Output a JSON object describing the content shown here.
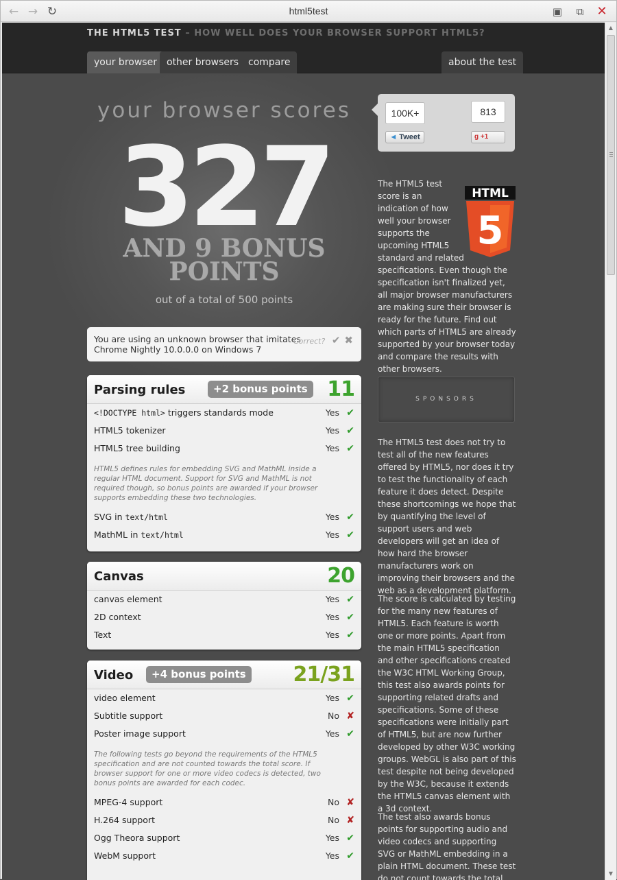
{
  "window": {
    "title": "html5test",
    "icons": {
      "back": "arrow-left-icon",
      "forward": "arrow-right-icon",
      "reload": "reload-icon",
      "fullscreen": "fullscreen-icon",
      "restore": "restore-icon",
      "close": "close-icon"
    }
  },
  "header": {
    "title": "THE HTML5 TEST",
    "subtitle": "– HOW WELL DOES YOUR BROWSER SUPPORT HTML5?",
    "tabs": [
      {
        "label": "your browser"
      },
      {
        "label": "other browsers"
      },
      {
        "label": "compare"
      },
      {
        "label": "about the test"
      }
    ]
  },
  "score": {
    "heading": "your browser scores",
    "value": "327",
    "bonus_line1": "AND 9 BONUS",
    "bonus_line2": "POINTS",
    "out_of": "out of a total of 500 points"
  },
  "browser_info": {
    "line1": "You are using an unknown browser that imitates",
    "line2": "Chrome Nightly 10.0.0.0 on Windows 7",
    "correct_label": "Correct?"
  },
  "social": {
    "tweet_count": "100K+",
    "tweet_label": "Tweet",
    "plus_count": "813",
    "plus_label": "+1"
  },
  "sections": [
    {
      "title": "Parsing rules",
      "bonus": "+2 bonus points",
      "score": "11",
      "rows": [
        {
          "code": "<!DOCTYPE html>",
          "label": " triggers standards mode",
          "result": "Yes",
          "pass": true
        },
        {
          "label": "HTML5 tokenizer",
          "result": "Yes",
          "pass": true
        },
        {
          "label": "HTML5 tree building",
          "result": "Yes",
          "pass": true
        }
      ],
      "note": "HTML5 defines rules for embedding SVG and MathML inside a regular HTML document. Support for SVG and MathML is not required though, so bonus points are awarded if your browser supports embedding these two technologies.",
      "bonus_rows": [
        {
          "label": "SVG in ",
          "code": "text/html",
          "result": "Yes",
          "pass": true
        },
        {
          "label": "MathML in ",
          "code": "text/html",
          "result": "Yes",
          "pass": true
        }
      ]
    },
    {
      "title": "Canvas",
      "score": "20",
      "rows": [
        {
          "label": "canvas element",
          "result": "Yes",
          "pass": true
        },
        {
          "label": "2D context",
          "result": "Yes",
          "pass": true
        },
        {
          "label": "Text",
          "result": "Yes",
          "pass": true
        }
      ]
    },
    {
      "title": "Video",
      "bonus": "+4 bonus points",
      "score": "21/31",
      "rows": [
        {
          "label": "video element",
          "result": "Yes",
          "pass": true
        },
        {
          "label": "Subtitle support",
          "result": "No",
          "pass": false
        },
        {
          "label": "Poster image support",
          "result": "Yes",
          "pass": true
        }
      ],
      "note": "The following tests go beyond the requirements of the HTML5 specification and are not counted towards the total score. If browser support for one or more video codecs is detected, two bonus points are awarded for each codec.",
      "bonus_rows": [
        {
          "label": "MPEG-4 support",
          "result": "No",
          "pass": false
        },
        {
          "label": "H.264 support",
          "result": "No",
          "pass": false
        },
        {
          "label": "Ogg Theora support",
          "result": "Yes",
          "pass": true
        },
        {
          "label": "WebM support",
          "result": "Yes",
          "pass": true
        }
      ]
    }
  ],
  "sidebar": {
    "intro": "The HTML5 test score is an indication of how well your browser supports the upcoming HTML5 standard and related specifications. Even though the specification isn't finalized yet, all major browser manufacturers are making sure their browser is ready for the future. Find out which parts of HTML5 are already supported by your browser today and compare the results with other browsers.",
    "html5_logo_text": "HTML",
    "html5_logo_number": "5",
    "sponsors_label": "SPONSORS",
    "para1": "The HTML5 test does not try to test all of the new features offered by HTML5, nor does it try to test the functionality of each feature it does detect. Despite these shortcomings we hope that by quantifying the level of support users and web developers will get an idea of how hard the browser manufacturers work on improving their browsers and the web as a development platform.",
    "para2": "The score is calculated by testing for the many new features of HTML5. Each feature is worth one or more points. Apart from the main HTML5 specification and other specifications created the W3C HTML Working Group, this test also awards points for supporting related drafts and specifications. Some of these specifications were initially part of HTML5, but are now further developed by other W3C working groups. WebGL is also part of this test despite not being developed by the W3C, because it extends the HTML5 canvas element with a 3d context.",
    "para3": "The test also awards bonus points for supporting audio and video codecs and supporting SVG or MathML embedding in a plain HTML document. These test do not count towards the total score because"
  },
  "colors": {
    "pass": "#2e9a2a",
    "fail": "#b22222",
    "score_green": "#3da32e",
    "html5_orange": "#e44d26"
  }
}
